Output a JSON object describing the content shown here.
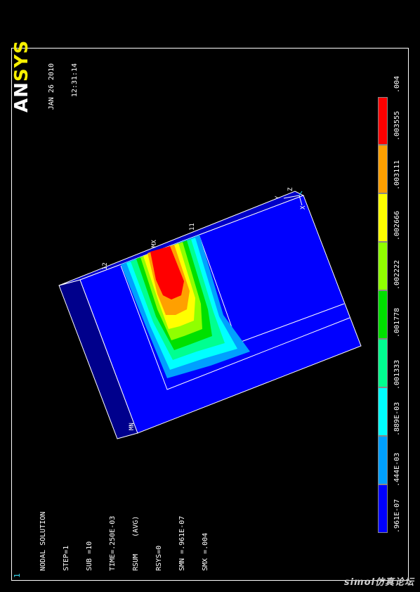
{
  "window": {
    "number": "1"
  },
  "logo": {
    "an": "AN",
    "sys": "SYS"
  },
  "timestamp": {
    "date": "JAN 26 2010",
    "time": "12:31:14"
  },
  "info": {
    "lines": [
      "NODAL SOLUTION",
      "STEP=1",
      "SUB =10",
      "TIME=.250E-03",
      "RSUM    (AVG)",
      "RSYS=0",
      "SMN =.961E-07",
      "SMX =.004"
    ]
  },
  "legend": {
    "labels": [
      ".961E-07",
      ".444E-03",
      ".889E-03",
      ".001333",
      ".001778",
      ".002222",
      ".002666",
      ".003111",
      ".003555",
      ".004"
    ],
    "colors": [
      "#0000ff",
      "#00a0ff",
      "#00ffff",
      "#00ff90",
      "#00e000",
      "#90ff00",
      "#ffff00",
      "#ffa000",
      "#ff0000"
    ]
  },
  "model_labels": {
    "mx": "MX",
    "mn": "MN",
    "n11": "11",
    "n12": "12",
    "axis_y": "Y",
    "axis_z": "Z",
    "axis_x": "X"
  },
  "watermark": "simol仿真论坛"
}
